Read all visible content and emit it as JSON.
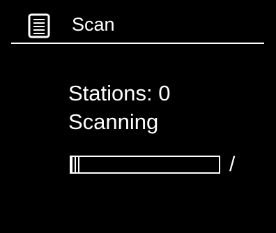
{
  "header": {
    "title": "Scan",
    "icon": "menu-list-icon"
  },
  "status": {
    "stations_line": "Stations: 0",
    "scanning_line": "Scanning"
  },
  "progress": {
    "fraction": 0.06,
    "spinner": "/"
  },
  "colors": {
    "background": "#000000",
    "foreground": "#ffffff"
  }
}
